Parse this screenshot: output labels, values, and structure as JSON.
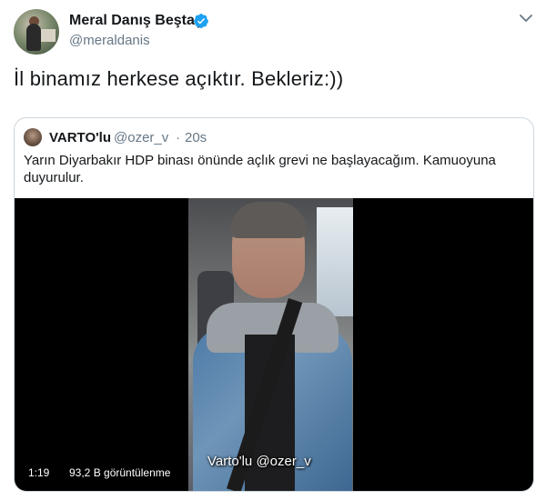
{
  "tweet": {
    "author_name": "Meral Danış Beştaş",
    "author_handle": "@meraldanis",
    "verified_icon": "verified-badge-icon",
    "text": "İl binamız herkese açıktır. Bekleriz:))",
    "colors": {
      "verified": "#1da1f2",
      "handle": "#657786",
      "border": "#ccd6dd"
    }
  },
  "quoted_tweet": {
    "author_name": "VARTO'lu",
    "author_handle": "@ozer_v",
    "separator": "·",
    "time": "20s",
    "text": "Yarın Diyarbakır HDP binası önünde açlık grevi ne başlayacağım. Kamuoyuna duyurulur.",
    "video": {
      "overlay_caption": "Varto'lu  @ozer_v",
      "duration": "1:19",
      "views": "93,2 B görüntülenme"
    }
  }
}
